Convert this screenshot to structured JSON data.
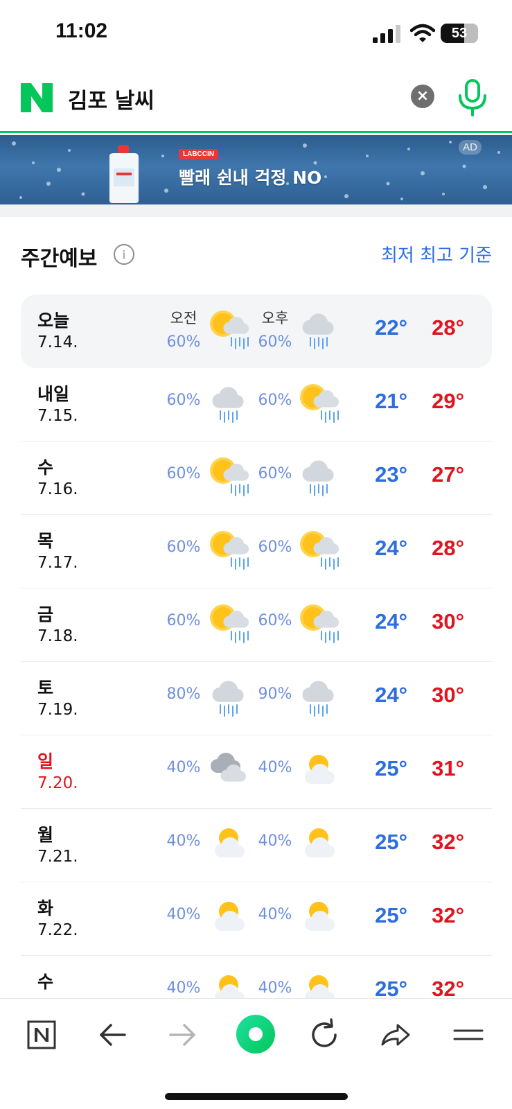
{
  "status_bar": {
    "time": "11:02",
    "battery": "53"
  },
  "search": {
    "query": "김포 날씨",
    "clear_icon": "close-icon",
    "mic_icon": "microphone-icon"
  },
  "ad": {
    "brand": "LABCCIN",
    "headline": "빨래 쉰내 걱정 NO",
    "tag": "AD"
  },
  "weekly": {
    "title": "주간예보",
    "basis": "최저 최고 기준",
    "am_label": "오전",
    "pm_label": "오후",
    "days": [
      {
        "day": "오늘",
        "date": "7.14.",
        "am_pct": "60%",
        "am_icon": "sun-rain",
        "pm_pct": "60%",
        "pm_icon": "rain",
        "low": "22°",
        "high": "28°"
      },
      {
        "day": "내일",
        "date": "7.15.",
        "am_pct": "60%",
        "am_icon": "rain",
        "pm_pct": "60%",
        "pm_icon": "sun-rain",
        "low": "21°",
        "high": "29°"
      },
      {
        "day": "수",
        "date": "7.16.",
        "am_pct": "60%",
        "am_icon": "sun-rain",
        "pm_pct": "60%",
        "pm_icon": "rain",
        "low": "23°",
        "high": "27°"
      },
      {
        "day": "목",
        "date": "7.17.",
        "am_pct": "60%",
        "am_icon": "sun-rain",
        "pm_pct": "60%",
        "pm_icon": "sun-rain",
        "low": "24°",
        "high": "28°"
      },
      {
        "day": "금",
        "date": "7.18.",
        "am_pct": "60%",
        "am_icon": "sun-rain",
        "pm_pct": "60%",
        "pm_icon": "sun-rain",
        "low": "24°",
        "high": "30°"
      },
      {
        "day": "토",
        "date": "7.19.",
        "am_pct": "80%",
        "am_icon": "rain",
        "pm_pct": "90%",
        "pm_icon": "rain",
        "low": "24°",
        "high": "30°"
      },
      {
        "day": "일",
        "date": "7.20.",
        "am_pct": "40%",
        "am_icon": "cloudy",
        "pm_pct": "40%",
        "pm_icon": "partly-cloudy",
        "low": "25°",
        "high": "31°",
        "sunday": true
      },
      {
        "day": "월",
        "date": "7.21.",
        "am_pct": "40%",
        "am_icon": "partly-cloudy",
        "pm_pct": "40%",
        "pm_icon": "partly-cloudy",
        "low": "25°",
        "high": "32°"
      },
      {
        "day": "화",
        "date": "7.22.",
        "am_pct": "40%",
        "am_icon": "partly-cloudy",
        "pm_pct": "40%",
        "pm_icon": "partly-cloudy",
        "low": "25°",
        "high": "32°"
      },
      {
        "day": "수",
        "date": "",
        "am_pct": "40%",
        "am_icon": "partly-cloudy",
        "pm_pct": "40%",
        "pm_icon": "partly-cloudy",
        "low": "25°",
        "high": "32°"
      }
    ]
  },
  "toolbar": {
    "items": [
      "naver-home-icon",
      "back-arrow-icon",
      "forward-arrow-icon",
      "green-dot-icon",
      "reload-icon",
      "share-icon",
      "menu-icon"
    ]
  },
  "colors": {
    "accent_green": "#03c75a",
    "low_temp": "#2c6de0",
    "high_temp": "#e0141e",
    "rain_pct": "#6f8fe0"
  }
}
